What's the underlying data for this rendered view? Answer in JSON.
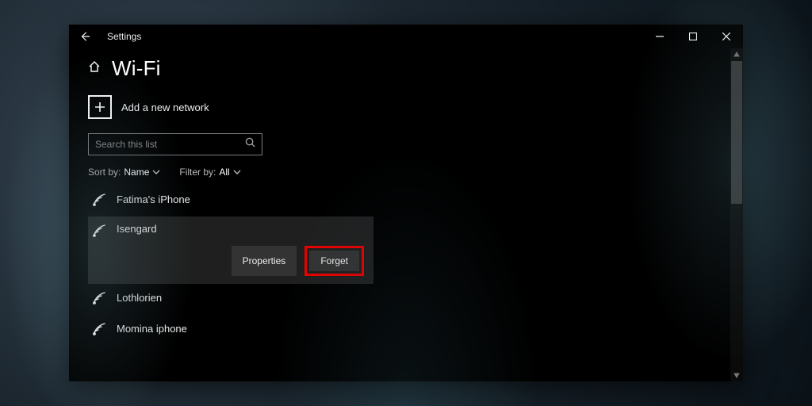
{
  "window": {
    "title": "Settings"
  },
  "page": {
    "title": "Wi-Fi"
  },
  "add_network": {
    "label": "Add a new network"
  },
  "search": {
    "placeholder": "Search this list",
    "value": ""
  },
  "sort": {
    "label": "Sort by:",
    "value": "Name"
  },
  "filter": {
    "label": "Filter by:",
    "value": "All"
  },
  "networks": [
    {
      "name": "Fatima's iPhone"
    },
    {
      "name": "Isengard"
    },
    {
      "name": "Lothlorien"
    },
    {
      "name": "Momina iphone"
    }
  ],
  "selected_index": 1,
  "buttons": {
    "properties": "Properties",
    "forget": "Forget"
  }
}
